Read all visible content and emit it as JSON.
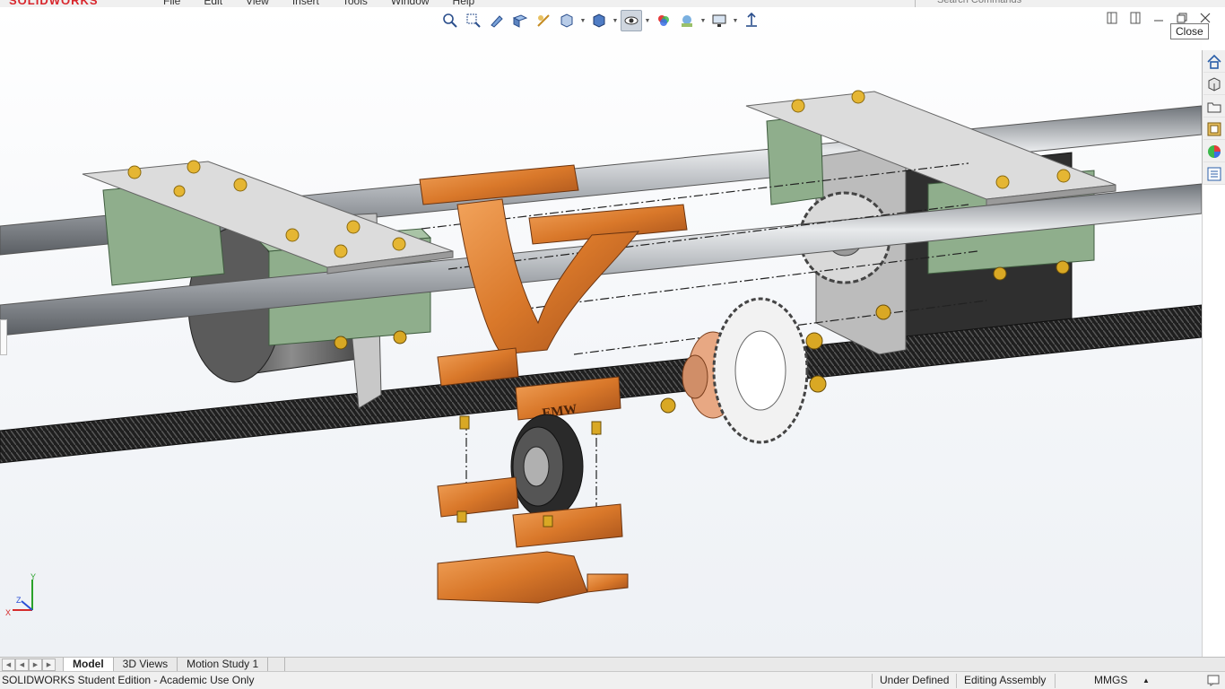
{
  "app": {
    "name": "SOLIDWORKS"
  },
  "menu": {
    "items": [
      "File",
      "Edit",
      "View",
      "Insert",
      "Tools",
      "Window",
      "Help"
    ]
  },
  "search": {
    "placeholder": "Search Commands"
  },
  "hud": {
    "tools": [
      "zoom-to-fit-icon",
      "zoom-to-area-icon",
      "previous-view-icon",
      "section-view-icon",
      "dynamic-annotation-icon",
      "view-orientation-icon",
      "display-style-icon",
      "hide-show-items-icon",
      "edit-appearance-icon",
      "apply-scene-icon",
      "view-settings-icon",
      "normal-to-icon"
    ]
  },
  "window": {
    "close_tooltip": "Close"
  },
  "taskpane": {
    "tabs": [
      "home-icon",
      "design-library-icon",
      "file-explorer-icon",
      "view-palette-icon",
      "appearances-icon",
      "custom-properties-icon"
    ]
  },
  "model": {
    "engraving": "EMW"
  },
  "tabs": [
    {
      "label": "Model",
      "active": true
    },
    {
      "label": "3D Views",
      "active": false
    },
    {
      "label": "Motion Study 1",
      "active": false
    }
  ],
  "status": {
    "product": "SOLIDWORKS Student Edition - Academic Use Only",
    "definition": "Under Defined",
    "mode": "Editing Assembly",
    "units": "MMGS"
  },
  "colors": {
    "accent": "#1e6fd9",
    "orange_part": "#d9782a",
    "green_block": "#8fae8c",
    "plate": "#dcdcdc"
  }
}
